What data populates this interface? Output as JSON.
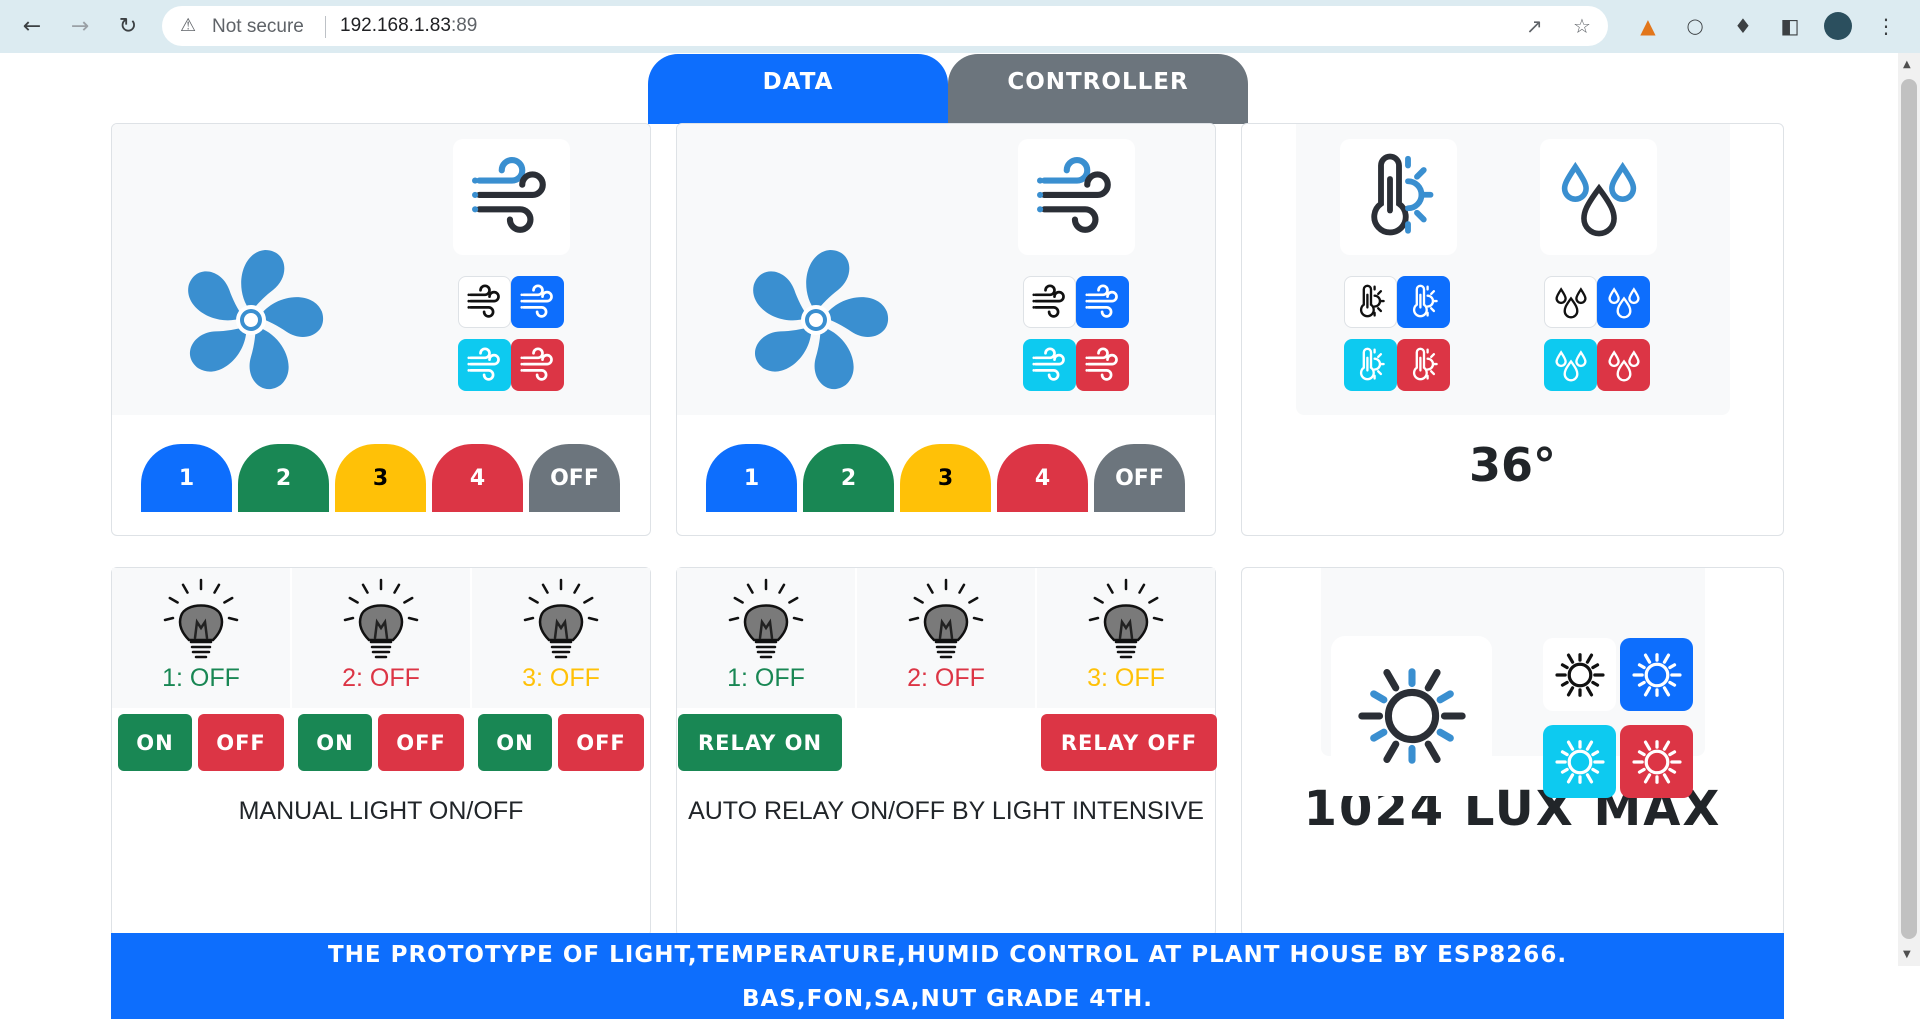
{
  "browser": {
    "security_text": "Not secure",
    "url_host": "192.168.1.83",
    "url_port": ":89"
  },
  "tabs": [
    {
      "label": "DATA",
      "active": true,
      "color": "#0d6efd"
    },
    {
      "label": "CONTROLLER",
      "active": false,
      "color": "#6c757d"
    }
  ],
  "fan_panels": [
    {
      "speeds": [
        "1",
        "2",
        "3",
        "4",
        "OFF"
      ]
    },
    {
      "speeds": [
        "1",
        "2",
        "3",
        "4",
        "OFF"
      ]
    }
  ],
  "speed_colors": [
    "#0d6efd",
    "#198754",
    "#ffc107",
    "#dc3545",
    "#6c757d"
  ],
  "temperature": {
    "value": "36°"
  },
  "manual_light": {
    "bulbs": [
      {
        "label": "1: OFF",
        "color": "#198754"
      },
      {
        "label": "2: OFF",
        "color": "#dc3545"
      },
      {
        "label": "3: OFF",
        "color": "#ffc107"
      }
    ],
    "on_label": "ON",
    "off_label": "OFF",
    "caption": "MANUAL LIGHT ON/OFF"
  },
  "auto_relay": {
    "bulbs": [
      {
        "label": "1: OFF",
        "color": "#198754"
      },
      {
        "label": "2: OFF",
        "color": "#dc3545"
      },
      {
        "label": "3: OFF",
        "color": "#ffc107"
      }
    ],
    "relay_on_label": "RELAY ON",
    "relay_off_label": "RELAY OFF",
    "caption": "AUTO RELAY ON/OFF BY LIGHT INTENSIVE"
  },
  "light_sensor": {
    "value": "1024 LUX MAX"
  },
  "footer": {
    "line1": "THE PROTOTYPE OF LIGHT,TEMPERATURE,HUMID CONTROL AT PLANT HOUSE BY ESP8266.",
    "line2": "BAS,FON,SA,NUT GRADE 4TH."
  }
}
